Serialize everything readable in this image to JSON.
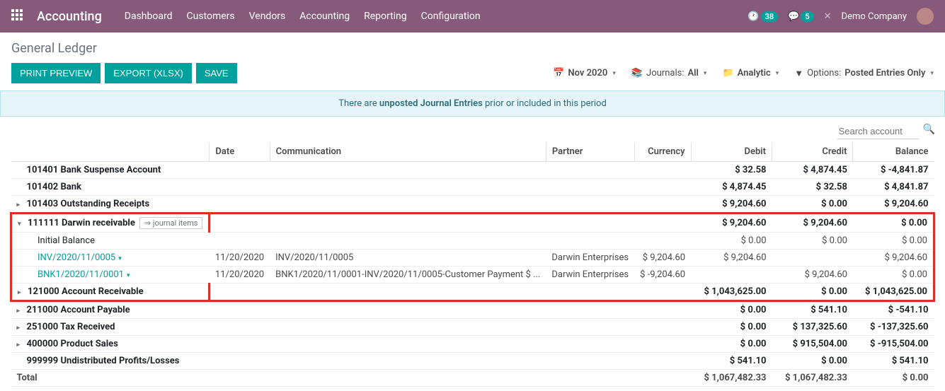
{
  "nav": {
    "brand": "Accounting",
    "menu": [
      "Dashboard",
      "Customers",
      "Vendors",
      "Accounting",
      "Reporting",
      "Configuration"
    ],
    "clock_badge": "38",
    "chat_badge": "5",
    "company": "Demo Company"
  },
  "page": {
    "title": "General Ledger",
    "buttons": {
      "print": "PRINT PREVIEW",
      "export": "EXPORT (XLSX)",
      "save": "SAVE"
    },
    "filters": {
      "date": "Nov 2020",
      "journals_label": "Journals:",
      "journals_value": "All",
      "analytic": "Analytic",
      "options_label": "Options:",
      "options_value": "Posted Entries Only"
    },
    "alert_pre": "There are ",
    "alert_bold": "unposted Journal Entries",
    "alert_post": " prior or included in this period",
    "search_placeholder": "Search account"
  },
  "table": {
    "headers": {
      "date": "Date",
      "comm": "Communication",
      "partner": "Partner",
      "curr": "Currency",
      "debit": "Debit",
      "credit": "Credit",
      "balance": "Balance"
    },
    "accounts": [
      {
        "name": "101401 Bank Suspense Account",
        "debit": "$ 32.58",
        "credit": "$ 4,874.45",
        "balance": "$ -4,841.87",
        "expandable": false
      },
      {
        "name": "101402 Bank",
        "debit": "$ 4,874.45",
        "credit": "$ 32.58",
        "balance": "$ 4,841.87",
        "expandable": false
      },
      {
        "name": "101403 Outstanding Receipts",
        "debit": "$ 9,204.60",
        "credit": "$ 0.00",
        "balance": "$ 9,204.60",
        "expandable": true
      },
      {
        "name": "111111 Darwin receivable",
        "debit": "$ 9,204.60",
        "credit": "$ 9,204.60",
        "balance": "$ 0.00",
        "expandable": true,
        "expanded": true,
        "journal_items": "⇒ journal items",
        "initial": {
          "label": "Initial Balance",
          "debit": "$ 0.00",
          "credit": "$ 0.00",
          "balance": "$ 0.00"
        },
        "entries": [
          {
            "ref": "INV/2020/11/0005",
            "date": "11/20/2020",
            "comm": "INV/2020/11/0005",
            "partner": "Darwin Enterprises",
            "curr": "$ 9,204.60",
            "debit": "$ 9,204.60",
            "credit": "",
            "balance": "$ 9,204.60"
          },
          {
            "ref": "BNK1/2020/11/0001",
            "date": "11/20/2020",
            "comm": "BNK1/2020/11/0001-INV/2020/11/0005-Customer Payment $ ...",
            "partner": "Darwin Enterprises",
            "curr": "$ -9,204.60",
            "debit": "",
            "credit": "$ 9,204.60",
            "balance": "$ 0.00"
          }
        ]
      },
      {
        "name": "121000 Account Receivable",
        "debit": "$ 1,043,625.00",
        "credit": "$ 0.00",
        "balance": "$ 1,043,625.00",
        "expandable": true
      },
      {
        "name": "211000 Account Payable",
        "debit": "$ 0.00",
        "credit": "$ 541.10",
        "balance": "$ -541.10",
        "expandable": true
      },
      {
        "name": "251000 Tax Received",
        "debit": "$ 0.00",
        "credit": "$ 137,325.60",
        "balance": "$ -137,325.60",
        "expandable": true
      },
      {
        "name": "400000 Product Sales",
        "debit": "$ 0.00",
        "credit": "$ 915,504.00",
        "balance": "$ -915,504.00",
        "expandable": true
      },
      {
        "name": "999999 Undistributed Profits/Losses",
        "debit": "$ 541.10",
        "credit": "$ 0.00",
        "balance": "$ 541.10",
        "expandable": false
      }
    ],
    "total": {
      "label": "Total",
      "debit": "$ 1,067,482.33",
      "credit": "$ 1,067,482.33",
      "balance": "$ 0.00"
    }
  }
}
